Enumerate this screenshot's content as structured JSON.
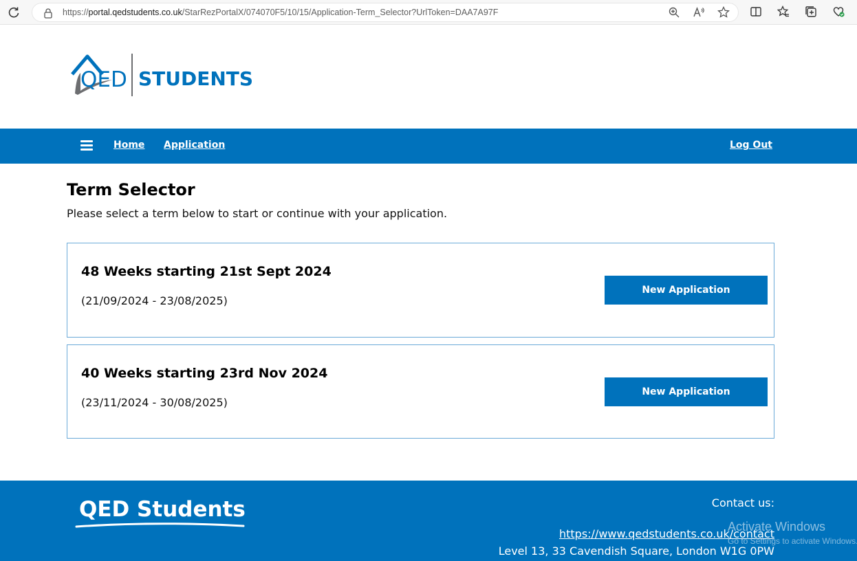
{
  "browser": {
    "url_prefix": "https://",
    "url_host": "portal.qedstudents.co.uk",
    "url_path": "/StarRezPortalX/074070F5/10/15/Application-Term_Selector?UrlToken=DAA7A97F",
    "icons": [
      "reload-icon",
      "lock-icon",
      "zoom-icon",
      "read-aloud-icon",
      "favorite-star-icon",
      "split-screen-icon",
      "favorites-icon",
      "collections-icon",
      "browser-essentials-icon"
    ]
  },
  "header": {
    "logo_text_left": "QED",
    "logo_text_right": "STUDENTS"
  },
  "nav": {
    "home": "Home",
    "application": "Application",
    "logout": "Log Out"
  },
  "main": {
    "title": "Term Selector",
    "subtitle": "Please select a term below to start or continue with your application.",
    "terms": [
      {
        "title": "48 Weeks starting 21st Sept 2024",
        "dates": "(21/09/2024 - 23/08/2025)",
        "button": "New Application"
      },
      {
        "title": "40 Weeks starting 23rd Nov 2024",
        "dates": "(23/11/2024 - 30/08/2025)",
        "button": "New Application"
      }
    ]
  },
  "footer": {
    "logo": "QED Students",
    "contact_label": "Contact us:",
    "contact_link": "https://www.qedstudents.co.uk/contact",
    "address": "Level 13, 33 Cavendish Square, London W1G 0PW"
  },
  "watermark": {
    "title": "Activate Windows",
    "subtitle": "Go to Settings to activate Windows."
  },
  "colors": {
    "brand_blue": "#0072bc",
    "card_border": "#6aa9d8",
    "logo_grey": "#6d6e71"
  }
}
